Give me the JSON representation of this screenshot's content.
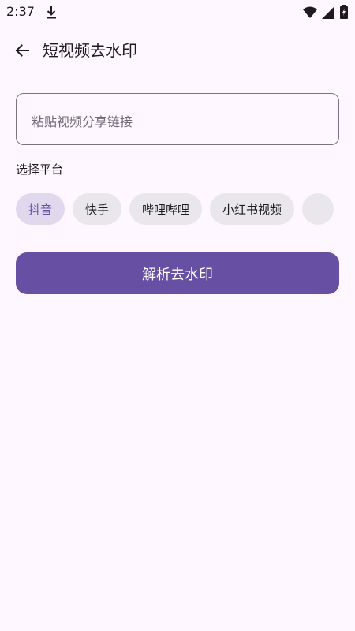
{
  "status_bar": {
    "time": "2:37",
    "icons": [
      "download-icon",
      "wifi-icon",
      "signal-icon",
      "battery-icon"
    ]
  },
  "app_bar": {
    "back_icon": "arrow-back-icon",
    "title": "短视频去水印"
  },
  "link_input": {
    "placeholder": "粘贴视频分享链接",
    "value": ""
  },
  "platform_section": {
    "label": "选择平台",
    "chips": [
      {
        "label": "抖音",
        "selected": true
      },
      {
        "label": "快手",
        "selected": false
      },
      {
        "label": "哔哩哔哩",
        "selected": false
      },
      {
        "label": "小红书视频",
        "selected": false
      },
      {
        "label": "",
        "selected": false
      }
    ]
  },
  "actions": {
    "parse_label": "解析去水印"
  },
  "colors": {
    "background": "#FEF7FF",
    "primary": "#674FA3",
    "chip_selected_bg": "#E0D9EE",
    "chip_bg": "#E9E7EB",
    "outline": "#79747E"
  }
}
